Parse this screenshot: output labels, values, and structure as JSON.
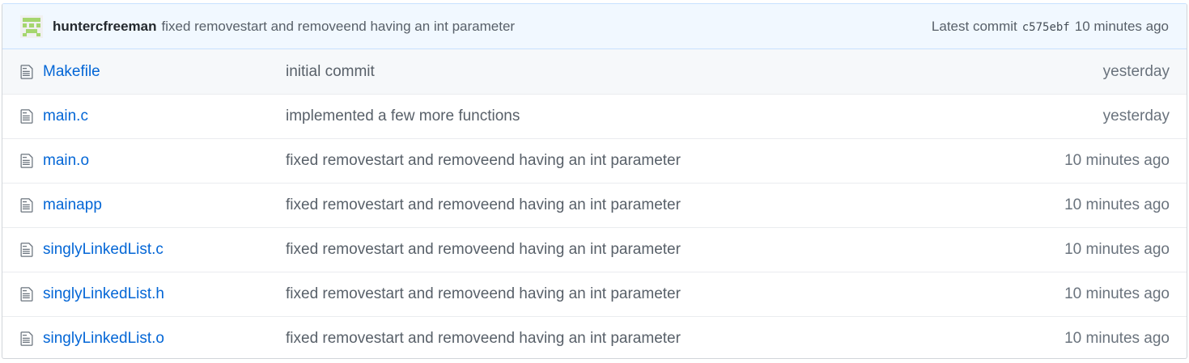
{
  "commit": {
    "author": "huntercfreeman",
    "message": "fixed removestart and removeend having an int parameter",
    "latest_label": "Latest commit",
    "sha": "c575ebf",
    "time": "10 minutes ago"
  },
  "files": [
    {
      "name": "Makefile",
      "message": "initial commit",
      "age": "yesterday",
      "icon": "file-icon"
    },
    {
      "name": "main.c",
      "message": "implemented a few more functions",
      "age": "yesterday",
      "icon": "file-icon"
    },
    {
      "name": "main.o",
      "message": "fixed removestart and removeend having an int parameter",
      "age": "10 minutes ago",
      "icon": "file-icon"
    },
    {
      "name": "mainapp",
      "message": "fixed removestart and removeend having an int parameter",
      "age": "10 minutes ago",
      "icon": "file-icon"
    },
    {
      "name": "singlyLinkedList.c",
      "message": "fixed removestart and removeend having an int parameter",
      "age": "10 minutes ago",
      "icon": "file-icon"
    },
    {
      "name": "singlyLinkedList.h",
      "message": "fixed removestart and removeend having an int parameter",
      "age": "10 minutes ago",
      "icon": "file-icon"
    },
    {
      "name": "singlyLinkedList.o",
      "message": "fixed removestart and removeend having an int parameter",
      "age": "10 minutes ago",
      "icon": "file-icon"
    }
  ],
  "colors": {
    "link": "#0366d6",
    "commit_bar_bg": "#f1f8ff",
    "muted_text": "#586069",
    "avatar": "#a5d66e"
  }
}
